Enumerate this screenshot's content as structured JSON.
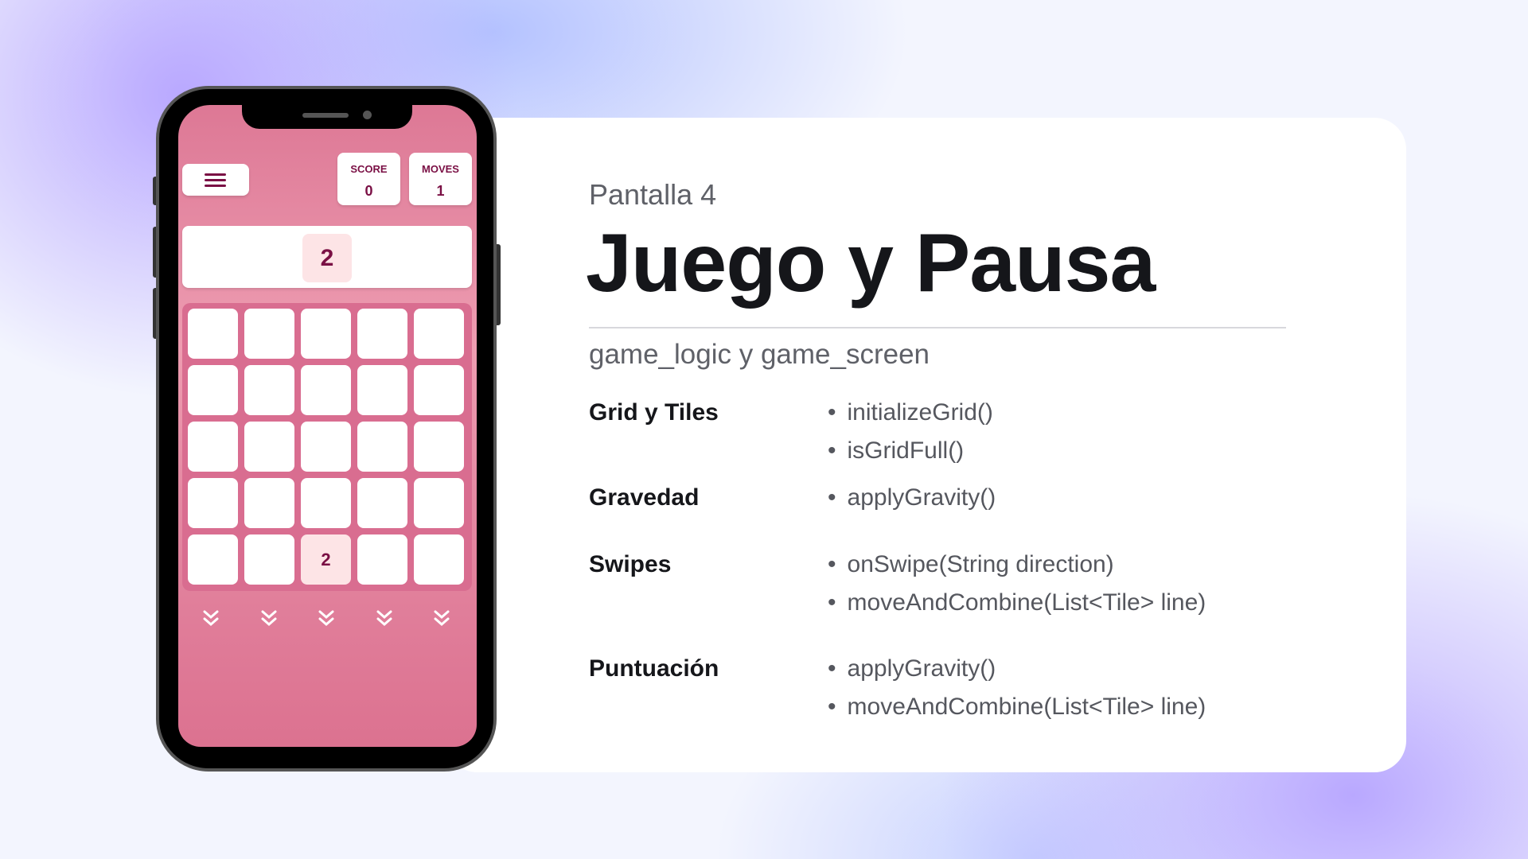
{
  "slide": {
    "pre_title": "Pantalla 4",
    "title": "Juego y Pausa",
    "subtitle": "game_logic y game_screen"
  },
  "sections": [
    {
      "label": "Grid y Tiles",
      "items": [
        "initializeGrid()",
        "isGridFull()"
      ]
    },
    {
      "label": "Gravedad",
      "items": [
        "applyGravity()"
      ]
    },
    {
      "label": "Swipes",
      "items": [
        "onSwipe(String direction)",
        "moveAndCombine(List<Tile> line)"
      ]
    },
    {
      "label": "Puntuación",
      "items": [
        "applyGravity()",
        "moveAndCombine(List<Tile> line)"
      ]
    }
  ],
  "game": {
    "score_label": "SCORE",
    "score": "0",
    "moves_label": "MOVES",
    "moves": "1",
    "next_tile": "2",
    "grid": [
      [
        "",
        "",
        "",
        "",
        ""
      ],
      [
        "",
        "",
        "",
        "",
        ""
      ],
      [
        "",
        "",
        "",
        "",
        ""
      ],
      [
        "",
        "",
        "",
        "",
        ""
      ],
      [
        "",
        "",
        "2",
        "",
        ""
      ]
    ],
    "colors": {
      "accent": "#7a0f44",
      "screen": "#e58aa3",
      "tile_filled": "#fde4e6"
    }
  }
}
